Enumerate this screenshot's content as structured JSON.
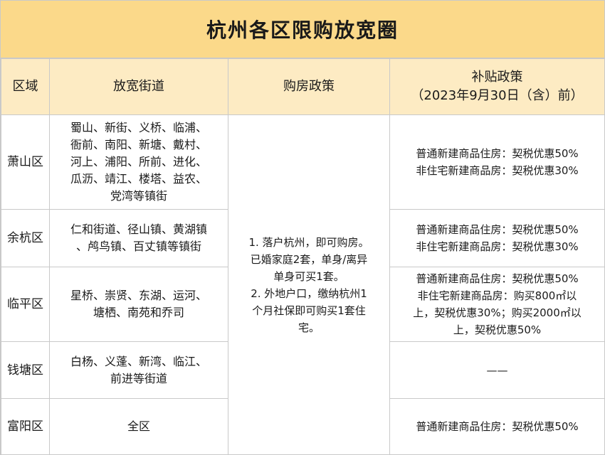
{
  "title": "杭州各区限购放宽圈",
  "headers": {
    "region": "区域",
    "streets": "放宽街道",
    "purchase": "购房政策",
    "subsidy_title": "补贴政策",
    "subsidy_note": "（2023年9月30日（含）前）"
  },
  "purchase_policy": {
    "line1": "1. 落户杭州，即可购房。",
    "line2": "已婚家庭2套，单身/离异",
    "line3": "单身可买1套。",
    "line4": "2. 外地户口，缴纳杭州1",
    "line5": "个月社保即可购买1套住",
    "line6": "宅。"
  },
  "rows": [
    {
      "region": "萧山区",
      "streets": [
        "蜀山、新街、义桥、临浦、",
        "衙前、南阳、新塘、戴村、",
        "河上、浦阳、所前、进化、",
        "瓜沥、靖江、楼塔、益农、",
        "党湾等镇街"
      ],
      "subsidy": [
        "普通新建商品住房：契税优惠50%",
        "非住宅新建商品房：契税优惠30%"
      ]
    },
    {
      "region": "余杭区",
      "streets": [
        "仁和街道、径山镇、黄湖镇",
        "、鸬鸟镇、百丈镇等镇街"
      ],
      "subsidy": [
        "普通新建商品住房：契税优惠50%",
        "非住宅新建商品房：契税优惠30%"
      ]
    },
    {
      "region": "临平区",
      "streets": [
        "星桥、崇贤、东湖、运河、",
        "塘栖、南苑和乔司"
      ],
      "subsidy": [
        "普通新建商品住房：契税优惠50%",
        "非住宅新建商品房：购买800㎡以",
        "上，契税优惠30%；购买2000㎡以",
        "上，契税优惠50%"
      ]
    },
    {
      "region": "钱塘区",
      "streets": [
        "白杨、义蓬、新湾、临江、",
        "前进等街道"
      ],
      "subsidy": [
        "——"
      ]
    },
    {
      "region": "富阳区",
      "streets": [
        "全区"
      ],
      "subsidy": [
        "普通新建商品住房：契税优惠50%"
      ]
    }
  ]
}
